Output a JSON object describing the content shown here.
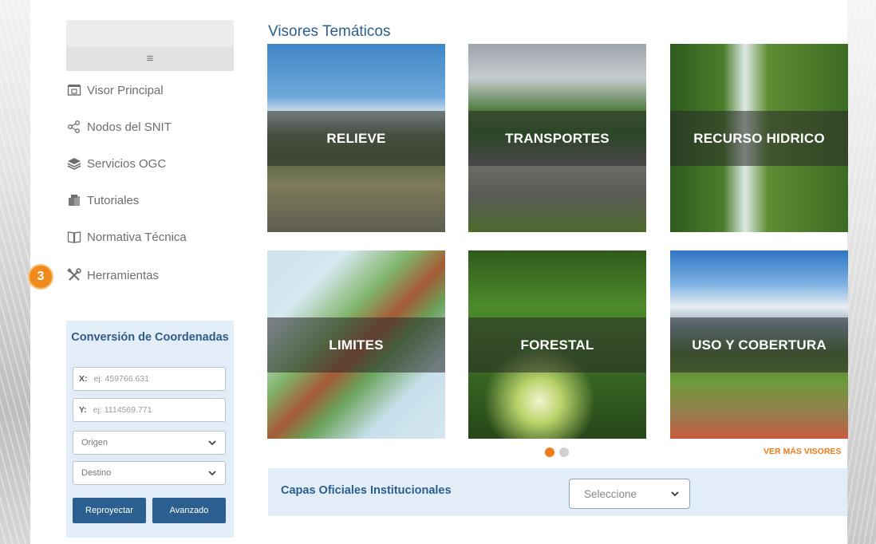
{
  "menu": {
    "toggle_icon": "≡",
    "items": [
      {
        "label": "Visor Principal",
        "icon": "map-viewer-icon"
      },
      {
        "label": "Nodos del SNIT",
        "icon": "share-nodes-icon"
      },
      {
        "label": "Servicios OGC",
        "icon": "layers-icon"
      },
      {
        "label": "Tutoriales",
        "icon": "boxes-icon"
      },
      {
        "label": "Normativa Técnica",
        "icon": "book-icon"
      },
      {
        "label": "Herramientas",
        "icon": "tools-icon"
      }
    ],
    "step_badge": "3",
    "step_badge_color": "#f08a1d"
  },
  "converter": {
    "title": "Conversión de Coordenadas",
    "x_label": "X:",
    "x_placeholder": "ej: 459766.631",
    "y_label": "Y:",
    "y_placeholder": "ej: 1114569.771",
    "origin_value": "Origen",
    "destination_value": "Destino",
    "reproject_label": "Reproyectar",
    "advanced_label": "Avanzado"
  },
  "main": {
    "title": "Visores Temáticos",
    "tiles": [
      {
        "label": "RELIEVE"
      },
      {
        "label": "TRANSPORTES"
      },
      {
        "label": "RECURSO HIDRICO"
      },
      {
        "label": "LIMITES"
      },
      {
        "label": "FORESTAL"
      },
      {
        "label": "USO Y COBERTURA"
      }
    ],
    "carousel_active": 1,
    "carousel_total": 2,
    "more_link": "VER MÁS VISORES"
  },
  "capas": {
    "label": "Capas Oficiales Institucionales",
    "select_value": "Seleccione"
  },
  "colors": {
    "brand_blue": "#2b5f8f",
    "accent_orange": "#f07b1a",
    "panel_bg": "#e3edf8"
  }
}
